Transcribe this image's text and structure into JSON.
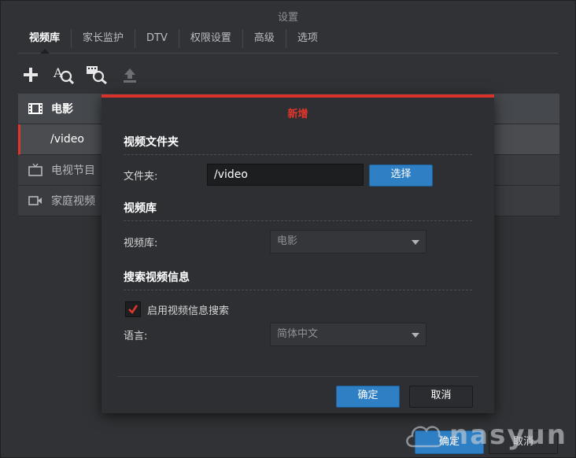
{
  "window": {
    "title": "设置"
  },
  "tabs": [
    {
      "label": "视频库"
    },
    {
      "label": "家长监护"
    },
    {
      "label": "DTV"
    },
    {
      "label": "权限设置"
    },
    {
      "label": "高级"
    },
    {
      "label": "选项"
    }
  ],
  "toolbar": {
    "icons": [
      "add-icon",
      "search-text-icon",
      "search-video-icon",
      "upload-icon"
    ]
  },
  "library": {
    "items": [
      {
        "label": "电影",
        "icon": "film-icon"
      },
      {
        "label": "/video"
      },
      {
        "label": "电视节目",
        "icon": "tv-icon"
      },
      {
        "label": "家庭视频",
        "icon": "camcorder-icon"
      }
    ]
  },
  "bottom": {
    "ok": "确定",
    "cancel": "取消"
  },
  "watermark": {
    "text": "nasyun"
  },
  "dialog": {
    "title": "新增",
    "folder_section": "视频文件夹",
    "folder_label": "文件夹:",
    "folder_value": "/video",
    "choose_button": "选择",
    "library_section": "视频库",
    "library_label": "视频库:",
    "library_value": "电影",
    "search_section": "搜索视频信息",
    "enable_search_label": "启用视频信息搜索",
    "enable_search_checked": true,
    "language_label": "语言:",
    "language_value": "简体中文",
    "ok_button": "确定",
    "cancel_button": "取消"
  },
  "colors": {
    "accent_red": "#d8322b",
    "accent_blue": "#2f7fc4"
  }
}
